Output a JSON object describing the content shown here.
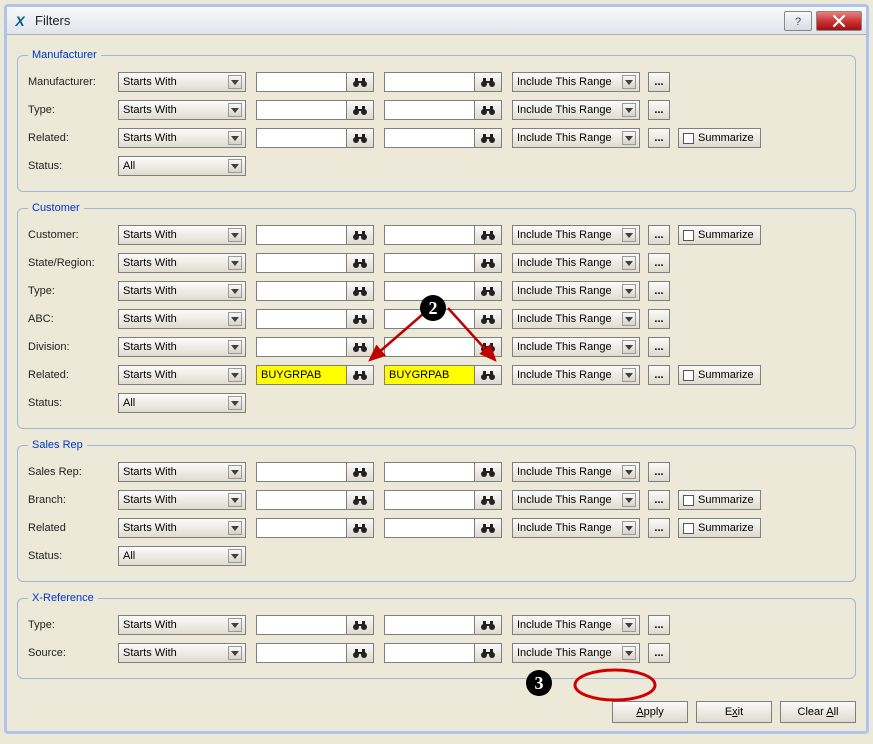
{
  "window": {
    "title": "Filters",
    "help_tip": "?",
    "close_tip": "X"
  },
  "dropdowns": {
    "starts_with": "Starts With",
    "all": "All",
    "include_range": "Include This Range"
  },
  "buttons": {
    "summarize": "Summarize",
    "apply": "Apply",
    "exit": "Exit",
    "clear_all": "Clear All",
    "ellipsis": "..."
  },
  "annotations": {
    "badge2": "2",
    "badge3": "3"
  },
  "groups": {
    "manufacturer": {
      "legend": "Manufacturer",
      "rows": [
        {
          "label": "Manufacturer:",
          "mode": "starts",
          "v1": "",
          "v2": "",
          "range": true,
          "ellipsis": true
        },
        {
          "label": "Type:",
          "mode": "starts",
          "v1": "",
          "v2": "",
          "range": true,
          "ellipsis": true
        },
        {
          "label": "Related:",
          "mode": "starts",
          "v1": "",
          "v2": "",
          "range": true,
          "ellipsis": true,
          "summarize": true
        },
        {
          "label": "Status:",
          "mode": "all"
        }
      ]
    },
    "customer": {
      "legend": "Customer",
      "rows": [
        {
          "label": "Customer:",
          "mode": "starts",
          "v1": "",
          "v2": "",
          "range": true,
          "ellipsis": true,
          "summarize": true
        },
        {
          "label": "State/Region:",
          "mode": "starts",
          "v1": "",
          "v2": "",
          "range": true,
          "ellipsis": true
        },
        {
          "label": "Type:",
          "mode": "starts",
          "v1": "",
          "v2": "",
          "range": true,
          "ellipsis": true
        },
        {
          "label": "ABC:",
          "mode": "starts",
          "v1": "",
          "v2": "",
          "range": true,
          "ellipsis": true
        },
        {
          "label": "Division:",
          "mode": "starts",
          "v1": "",
          "v2": "",
          "range": true,
          "ellipsis": true
        },
        {
          "label": "Related:",
          "mode": "starts",
          "v1": "BUYGRPAB",
          "v2": "BUYGRPAB",
          "range": true,
          "ellipsis": true,
          "summarize": true,
          "highlight": true
        },
        {
          "label": "Status:",
          "mode": "all"
        }
      ]
    },
    "salesrep": {
      "legend": "Sales Rep",
      "rows": [
        {
          "label": "Sales Rep:",
          "mode": "starts",
          "v1": "",
          "v2": "",
          "range": true,
          "ellipsis": true
        },
        {
          "label": "Branch:",
          "mode": "starts",
          "v1": "",
          "v2": "",
          "range": true,
          "ellipsis": true,
          "summarize": true
        },
        {
          "label": "Related",
          "mode": "starts",
          "v1": "",
          "v2": "",
          "range": true,
          "ellipsis": true,
          "summarize": true
        },
        {
          "label": "Status:",
          "mode": "all"
        }
      ]
    },
    "xref": {
      "legend": "X-Reference",
      "rows": [
        {
          "label": "Type:",
          "mode": "starts",
          "v1": "",
          "v2": "",
          "range": true,
          "ellipsis": true,
          "cursor": true
        },
        {
          "label": "Source:",
          "mode": "starts",
          "v1": "",
          "v2": "",
          "range": true,
          "ellipsis": true
        }
      ]
    }
  }
}
